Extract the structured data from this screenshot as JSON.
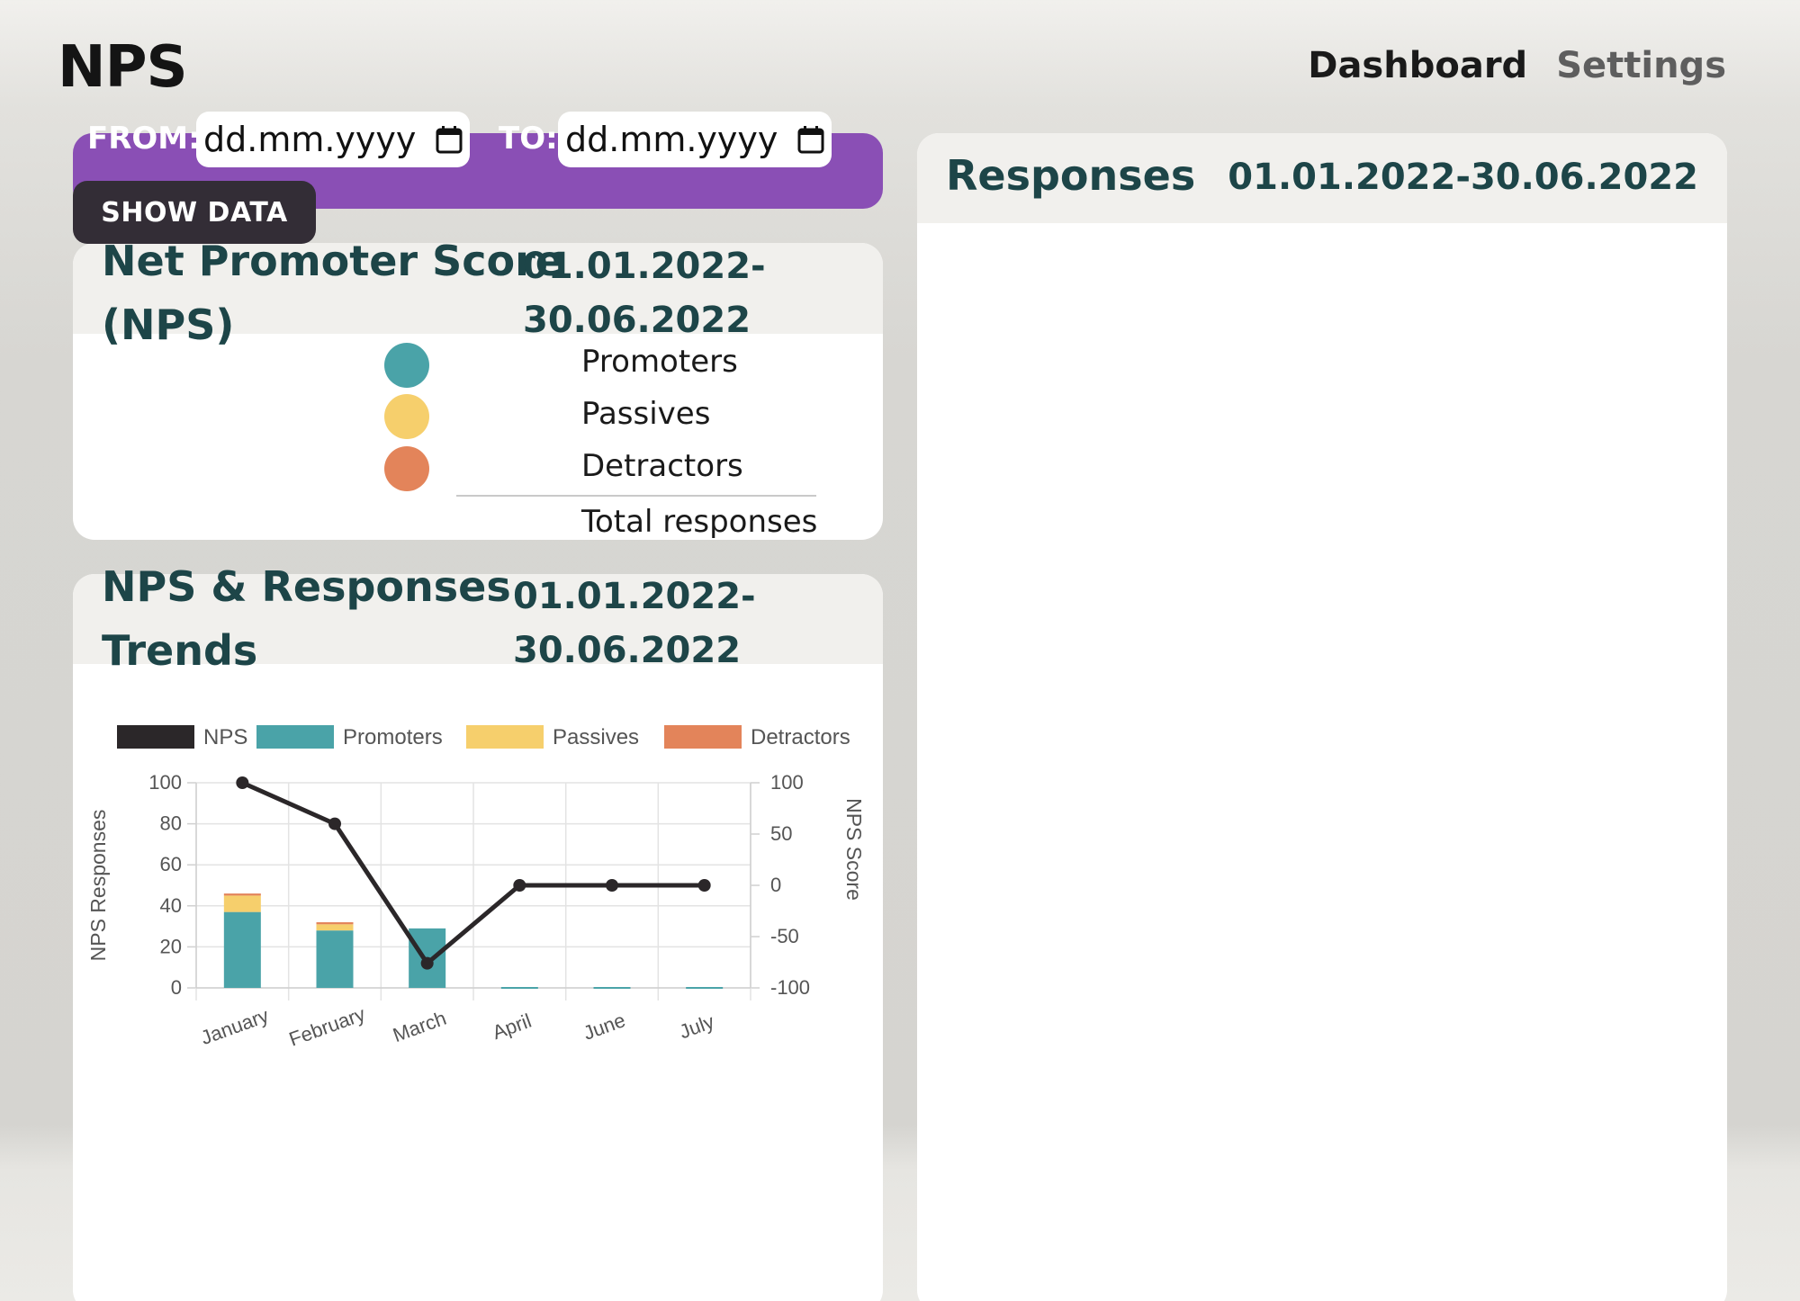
{
  "app": {
    "title": "NPS"
  },
  "nav": {
    "dashboard": "Dashboard",
    "settings": "Settings"
  },
  "filter": {
    "from_label": "FROM:",
    "from_placeholder": "dd.mm.yyyy",
    "to_label": "TO:",
    "to_placeholder": "dd.mm.yyyy",
    "show_button": "SHOW DATA",
    "bar_color": "#8a4fb5"
  },
  "nps_card": {
    "title_line1": "Net Promoter Score",
    "title_line2": "(NPS)",
    "date_line1": "01.01.2022-",
    "date_line2": "30.06.2022",
    "legend": [
      {
        "label": "Promoters",
        "color": "#4aa3a8"
      },
      {
        "label": "Passives",
        "color": "#f6cf6c"
      },
      {
        "label": "Detractors",
        "color": "#e3845a"
      }
    ],
    "total_label": "Total responses"
  },
  "trend_card": {
    "title_line1": "NPS & Responses",
    "title_line2": "Trends",
    "date_line1": "01.01.2022-",
    "date_line2": "30.06.2022"
  },
  "responses_card": {
    "title": "Responses",
    "date": "01.01.2022-30.06.2022"
  },
  "chart_data": {
    "type": "bar",
    "categories": [
      "January",
      "February",
      "March",
      "April",
      "June",
      "July"
    ],
    "stacked": true,
    "series": [
      {
        "name": "NPS",
        "type": "line",
        "axis": "right",
        "color": "#2b2729",
        "values": [
          100,
          60,
          -76,
          0,
          0,
          0
        ]
      },
      {
        "name": "Promoters",
        "type": "bar",
        "axis": "left",
        "color": "#4aa3a8",
        "values": [
          37,
          28,
          29,
          0,
          0,
          0
        ]
      },
      {
        "name": "Passives",
        "type": "bar",
        "axis": "left",
        "color": "#f6cf6c",
        "values": [
          8,
          3,
          0,
          0,
          0,
          0
        ]
      },
      {
        "name": "Detractors",
        "type": "bar",
        "axis": "left",
        "color": "#e3845a",
        "values": [
          1,
          1,
          0,
          0,
          0,
          0
        ]
      }
    ],
    "ylabel": "NPS Responses",
    "y2label": "NPS Score",
    "ylim": [
      0,
      100
    ],
    "y2lim": [
      -100,
      100
    ],
    "yticks": [
      "100",
      "80",
      "60",
      "40",
      "20",
      "0"
    ],
    "y2ticks": [
      "100",
      "50",
      "0",
      "-50",
      "-100"
    ],
    "grid": true,
    "legend_position": "top"
  }
}
